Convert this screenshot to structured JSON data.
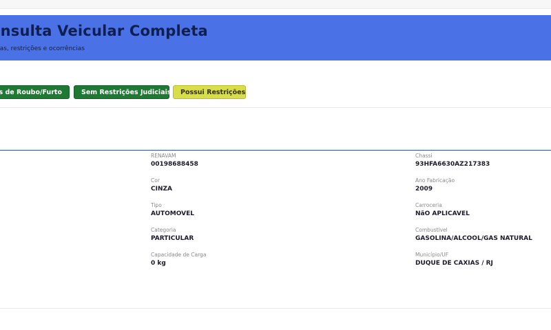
{
  "header": {
    "title": "onsulta Veicular Completa",
    "subtitle": "ultas, restrições e ocorrências"
  },
  "badges": [
    {
      "label": "ias de Roubo/Furto",
      "color": "#1e7a33"
    },
    {
      "label": "Sem Restrições Judiciais",
      "color": "#1e7a33"
    },
    {
      "label": "Possui Restrições",
      "color": "#d8de49"
    }
  ],
  "fields": {
    "renavam": {
      "label": "RENAVAM",
      "value": "00198688458"
    },
    "chassi": {
      "label": "Chassi",
      "value": "93HFA6630AZ217383"
    },
    "cor": {
      "label": "Cor",
      "value": "CINZA"
    },
    "ano_fabricacao": {
      "label": "Ano Fabricação",
      "value": "2009"
    },
    "tipo": {
      "label": "Tipo",
      "value": "AUTOMOVEL"
    },
    "carroceria": {
      "label": "Carroceria",
      "value": "NãO APLICAVEL"
    },
    "categoria": {
      "label": "Categoria",
      "value": "PARTICULAR"
    },
    "combustivel": {
      "label": "Combustivel",
      "value": "GASOLINA/ALCOOL/GAS NATURAL"
    },
    "capacidade_carga": {
      "label": "Capacidade de Carga",
      "value": "0 kg"
    },
    "municipio_uf": {
      "label": "Município/UF",
      "value": "DUQUE DE CAXIAS / RJ"
    }
  },
  "colors": {
    "header_bg": "#4a72e6",
    "header_text": "#0f1f4f",
    "badge_green": "#1e7a33",
    "badge_yellow": "#d8de49",
    "divider_blue": "#2c4fa8"
  }
}
